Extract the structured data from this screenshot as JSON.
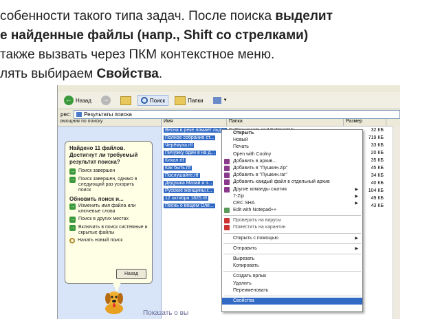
{
  "slide": {
    "line1_a": "собенности такого типа задач. После поиска ",
    "line1_b": "выделит",
    "line2": "е найденные файлы (напр., Shift со стрелками)",
    "line3": "также вызвать через ПКМ контекстное меню.",
    "line4_a": "лять выбираем ",
    "line4_b": "Свойства",
    "line4_c": "."
  },
  "toolbar": {
    "back_label": "Назад",
    "search_label": "Поиск",
    "folders_label": "Папки"
  },
  "address": {
    "label": "рес:",
    "value": "Результаты поиска"
  },
  "left_pane": {
    "header": "омощник по поиску",
    "found": "Найдено 11 файлов. Достигнут ли требуемый результат поиска?",
    "options1": [
      "Поиск завершен",
      "Поиск завершен, однако в следующий раз ускорить поиск"
    ],
    "refine_title": "Обновить поиск и...",
    "options2": [
      "Изменить имя файла или ключевые слова",
      "Поиск в других местах",
      "Включить в поиск системные и скрытые файлы",
      "Начать новый поиск"
    ],
    "back_button": "Назад"
  },
  "list": {
    "columns": [
      "Имя",
      "Папка",
      "Размер"
    ],
    "rows": [
      {
        "name": "Весна в реке ломает льды...",
        "folder": "C:\\Documents and Settings\\Vu...",
        "size": "32 КБ"
      },
      {
        "name": "Полное собрание ст...",
        "folder": "",
        "size": "719 КБ"
      },
      {
        "name": "Черёмуха.rtf",
        "folder": "",
        "size": "33 КБ"
      },
      {
        "name": "Пичужку один в на д...",
        "folder": "",
        "size": "20 КБ"
      },
      {
        "name": "Кихал.rtf",
        "folder": "",
        "size": "35 КБ"
      },
      {
        "name": "Как быть.rtf",
        "folder": "",
        "size": "45 КБ"
      },
      {
        "name": "Послушайте.rtf",
        "folder": "",
        "size": "34 КБ"
      },
      {
        "name": "Дедушка Мазай и з...",
        "folder": "",
        "size": "40 КБ"
      },
      {
        "name": "Русские женщины.r...",
        "folder": "",
        "size": "104 КБ"
      },
      {
        "name": "12 октября 1825.rtf",
        "folder": "",
        "size": "49 КБ"
      },
      {
        "name": "Песнь о вещем Оле...",
        "folder": "",
        "size": "43 КБ"
      }
    ]
  },
  "context_menu": [
    {
      "label": "Открыть",
      "bold": true
    },
    {
      "label": "Новый"
    },
    {
      "label": "Печать"
    },
    {
      "label": "Open with Coolny"
    },
    {
      "label": "Добавить в архив...",
      "icon": "#8a3a8a"
    },
    {
      "label": "Добавить в \"Пушкин.zip\"",
      "icon": "#8a3a8a"
    },
    {
      "label": "Добавить в \"Пушкин.rar\"",
      "icon": "#8a3a8a"
    },
    {
      "label": "Добавить каждый файл в отдельный архив",
      "icon": "#8a3a8a"
    },
    {
      "label": "Другие команды сжатия",
      "icon": "#8a3a8a",
      "sub": true
    },
    {
      "label": "7-Zip",
      "sub": true
    },
    {
      "label": "CRC SHA",
      "sub": true
    },
    {
      "label": "Edit with Notepad++",
      "icon": "#5a9a5a"
    },
    {
      "sep": true
    },
    {
      "label": "Проверить на вирусы",
      "icon": "#cc3333",
      "gray": true
    },
    {
      "label": "Поместить на карантин",
      "icon": "#cc3333",
      "gray": true
    },
    {
      "sep": true
    },
    {
      "label": "Открыть с помощью",
      "sub": true
    },
    {
      "sep": true
    },
    {
      "label": "Отправить",
      "sub": true
    },
    {
      "sep": true
    },
    {
      "label": "Вырезать"
    },
    {
      "label": "Копировать"
    },
    {
      "sep": true
    },
    {
      "label": "Создать ярлык"
    },
    {
      "label": "Удалить"
    },
    {
      "label": "Переименовать"
    },
    {
      "sep": true
    },
    {
      "label": "Свойства",
      "selected": true
    }
  ],
  "footer": "Показать о вы"
}
